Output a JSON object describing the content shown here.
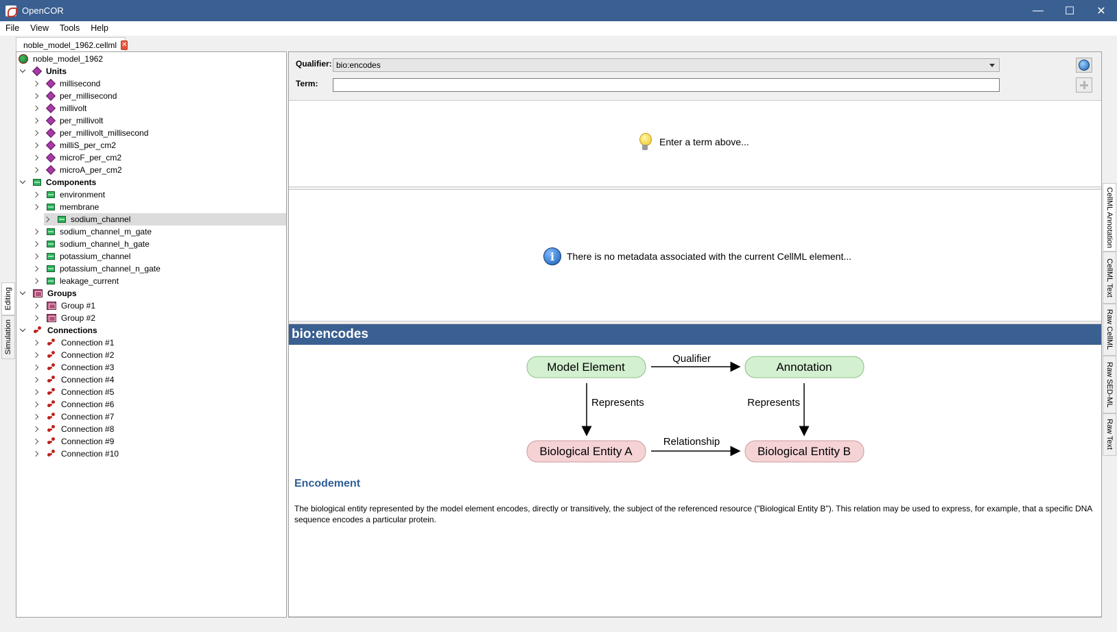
{
  "window": {
    "title": "OpenCOR",
    "minimize": "—",
    "maximize": "☐",
    "close": "✕"
  },
  "menu": [
    "File",
    "View",
    "Tools",
    "Help"
  ],
  "file_tab": {
    "label": "noble_model_1962.cellml",
    "close": "✕"
  },
  "left_vtabs": [
    "Editing",
    "Simulation"
  ],
  "right_vtabs": [
    "CellML Annotation",
    "CellML Text",
    "Raw CellML",
    "Raw SED-ML",
    "Raw Text"
  ],
  "tree": {
    "root": "noble_model_1962",
    "units_label": "Units",
    "units": [
      "millisecond",
      "per_millisecond",
      "millivolt",
      "per_millivolt",
      "per_millivolt_millisecond",
      "milliS_per_cm2",
      "microF_per_cm2",
      "microA_per_cm2"
    ],
    "components_label": "Components",
    "components": [
      "environment",
      "membrane",
      "sodium_channel",
      "sodium_channel_m_gate",
      "sodium_channel_h_gate",
      "potassium_channel",
      "potassium_channel_n_gate",
      "leakage_current"
    ],
    "selected_component": "sodium_channel",
    "groups_label": "Groups",
    "groups": [
      "Group #1",
      "Group #2"
    ],
    "connections_label": "Connections",
    "connections": [
      "Connection #1",
      "Connection #2",
      "Connection #3",
      "Connection #4",
      "Connection #5",
      "Connection #6",
      "Connection #7",
      "Connection #8",
      "Connection #9",
      "Connection #10"
    ]
  },
  "annotation": {
    "qualifier_label": "Qualifier:",
    "qualifier_value": "bio:encodes",
    "term_label": "Term:",
    "term_value": "",
    "hint_text": "Enter a term above...",
    "no_metadata_text": "There is no metadata associated with the current CellML element..."
  },
  "doc": {
    "header": "bio:encodes",
    "diagram": {
      "model_element": "Model Element",
      "annotation": "Annotation",
      "entity_a": "Biological Entity A",
      "entity_b": "Biological Entity B",
      "qualifier": "Qualifier",
      "represents_left": "Represents",
      "represents_right": "Represents",
      "relationship": "Relationship"
    },
    "title": "Encodement",
    "description": "The biological entity represented by the model element encodes, directly or transitively, the subject of the referenced resource (\"Biological Entity B\"). This relation may be used to express, for example, that a specific DNA sequence encodes a particular protein."
  }
}
